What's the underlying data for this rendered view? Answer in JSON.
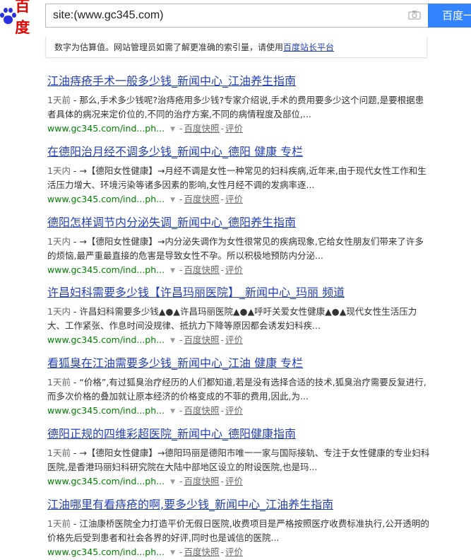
{
  "header": {
    "logo_text": "百度",
    "search_value": "site:(www.gc345.com)",
    "search_button": "百度一下"
  },
  "tip": {
    "text": "数字为估算值。网站管理员如需了解更准确的索引量，请使用",
    "link": "百度站长平台"
  },
  "results": [
    {
      "title": "江油痔疮手术一般多少钱_新闻中心_江油养生指南",
      "date": "1天前",
      "abstract": " - 那么,手术多少钱呢?治痔疮用多少钱?专家介绍说,手术的费用要多少这个问题,是要根据患者具体的病况来定价位的,不同的治疗方案,不同的病情程度及部位,...",
      "url": "www.gc345.com/ind...ph...",
      "snapshot": "百度快照",
      "review": "评价"
    },
    {
      "title": "在德阳治月经不调多少钱_新闻中心_德阳 健康 专栏",
      "date": "1天内",
      "abstract": " - →【德阳女性健康】→月经不调是女性一种常见的妇科疾病,近年来,由于现代女性工作和生活压力增大、环境污染等诸多因素的影响,女性月经不调的发病率逐...",
      "url": "www.gc345.com/ind...ph...",
      "snapshot": "百度快照",
      "review": "评价"
    },
    {
      "title": "德阳怎样调节内分泌失调_新闻中心_德阳养生指南",
      "date": "1天内",
      "abstract": " - →【德阳女性健康】→内分泌失调作为女性很常见的疾病现象,它给女性朋友们带来了许多的烦恼,最严重最直接的危害是导致女性不孕。所以积极地预防内分泌...",
      "url": "www.gc345.com/ind...ph...",
      "snapshot": "百度快照",
      "review": "评价"
    },
    {
      "title": "许昌妇科需要多少钱【许昌玛丽医院】_新闻中心_玛丽 频道",
      "date": "1天内",
      "abstract": " - 许昌妇科需要多少钱▲●▲许昌玛丽医院▲●▲呼吁关爱女性健康▲●▲现代女性生活压力大、工作紧张、作息时间没规律、抵抗力下降等原因都会诱发妇科疾...",
      "url": "www.gc345.com/ind...ph...",
      "snapshot": "百度快照",
      "review": "评价"
    },
    {
      "title": "看狐臭在江油需要多少钱_新闻中心_江油 健康 专栏",
      "date": "1天前",
      "abstract": " - “价格”,有过狐臭治疗经历的人们都知道,若是没有选择合适的技术,狐臭治疗需要反复进行,而多次价格的叠加就让原本经济的价格变成的不菲的费用,因此,为...",
      "url": "www.gc345.com/ind...ph...",
      "snapshot": "百度快照",
      "review": "评价"
    },
    {
      "title": "德阳正规的四维彩超医院_新闻中心_德阳健康指南",
      "date": "1天前",
      "abstract": " - →【德阳女性健康】→德阳玛丽是德阳市唯一一家与国际接轨、专注于女性健康的专业妇科医院,是香港玛丽妇科研究院在大陆中部地区设立的附设医院,也是玛...",
      "url": "www.gc345.com/ind...ph...",
      "snapshot": "百度快照",
      "review": "评价"
    },
    {
      "title": "江油哪里有看痔疮的啊,要多少钱_新闻中心_江油养生指南",
      "date": "1天前",
      "abstract": " - 江油康桥医院全力打造平价无假日医院,收费项目是严格按照医疗收费标准执行,公开透明的价格先后受到患者和社会各界的好评,同时也是诚信的医院...",
      "url": "www.gc345.com/ind...ph...",
      "snapshot": "百度快照",
      "review": "评价"
    }
  ],
  "colors": {
    "title_link": "#2440b3",
    "url_green": "#008000",
    "search_button_bg": "#3385ff",
    "logo_red": "#e10602",
    "logo_blue": "#2932e1"
  },
  "icons": [
    "baidu-paw-logo-icon",
    "camera-icon",
    "dropdown-arrow-icon"
  ]
}
